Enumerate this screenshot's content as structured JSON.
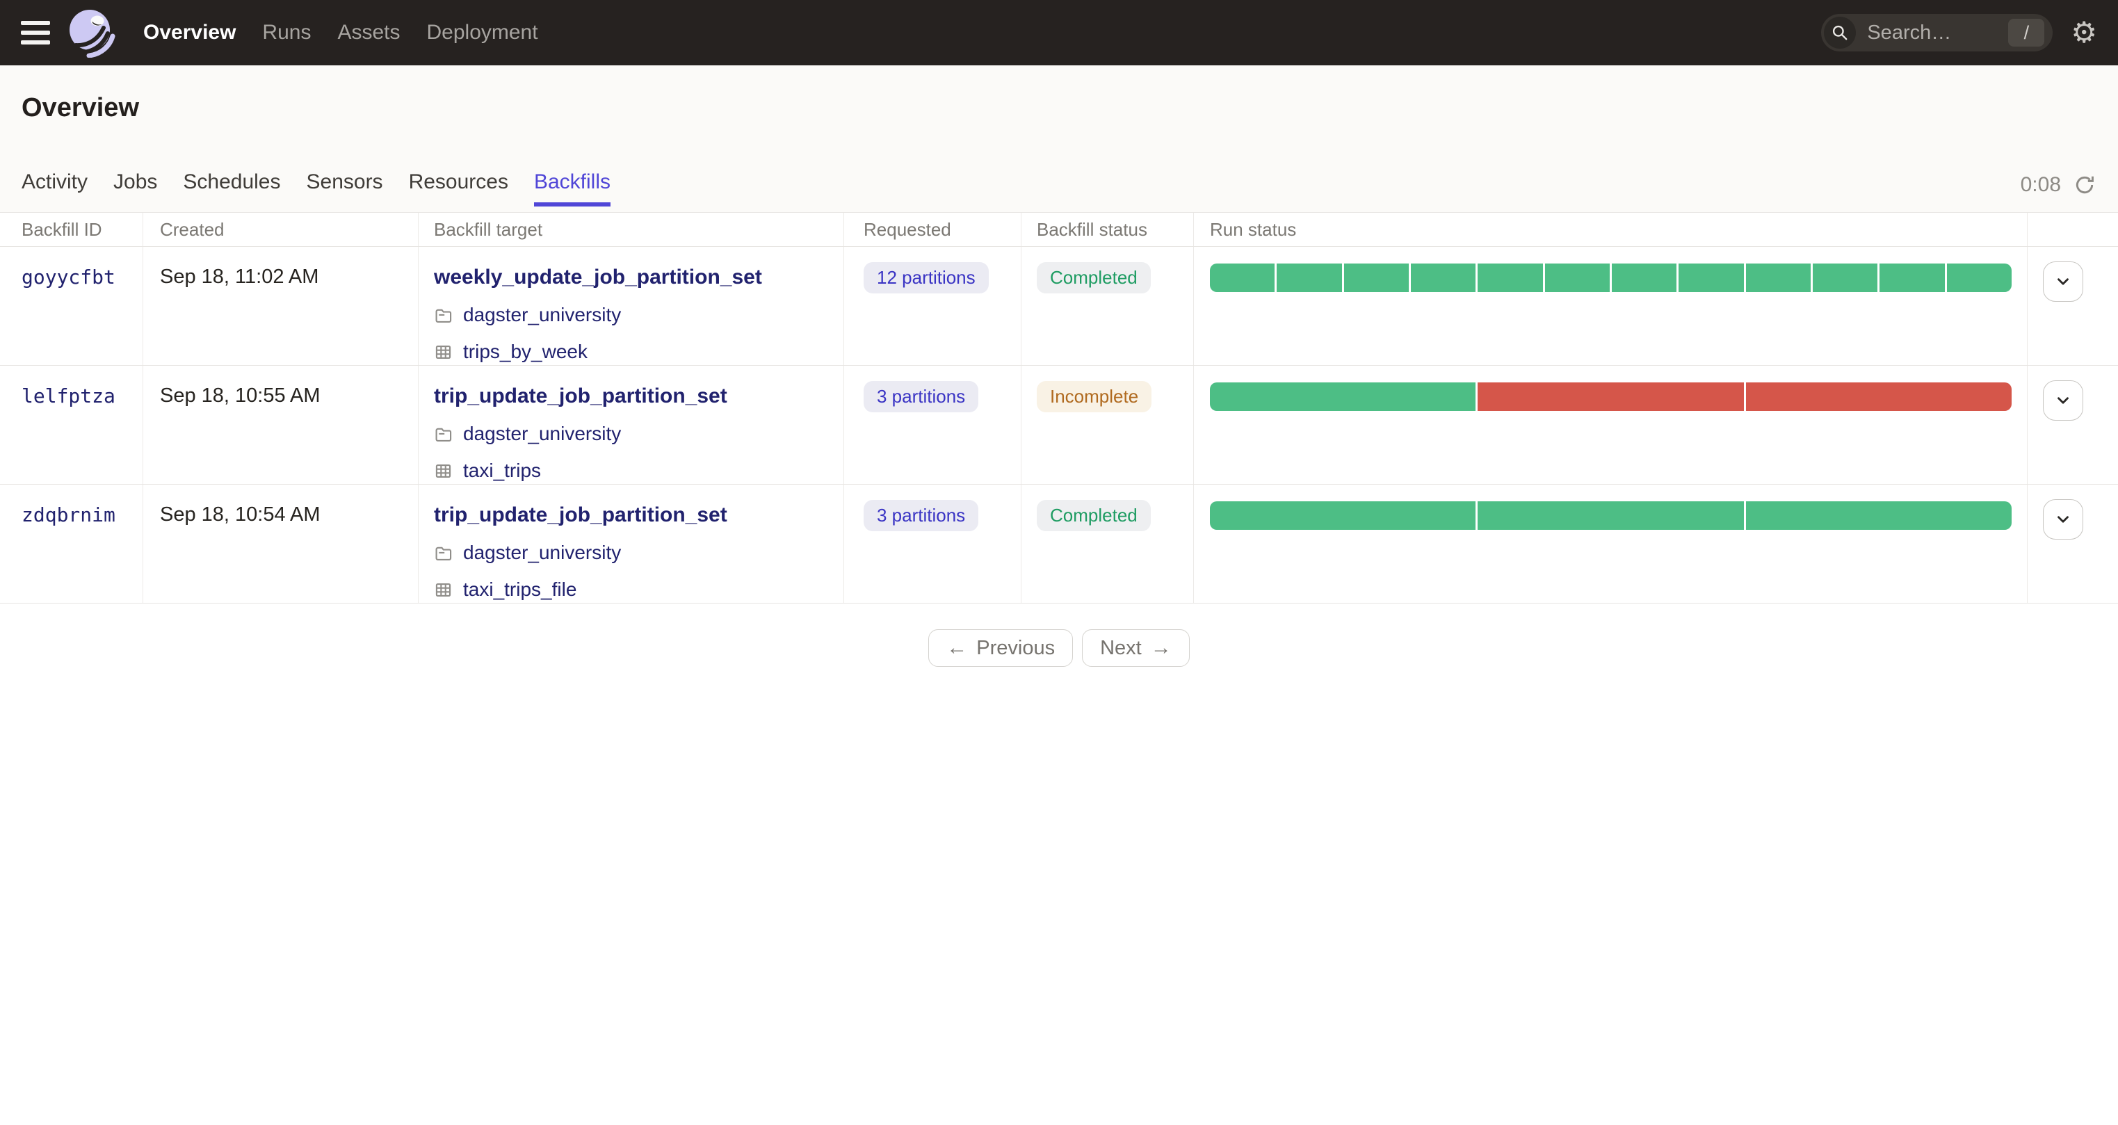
{
  "nav": {
    "items": [
      {
        "label": "Overview",
        "active": true
      },
      {
        "label": "Runs",
        "active": false
      },
      {
        "label": "Assets",
        "active": false
      },
      {
        "label": "Deployment",
        "active": false
      }
    ],
    "search": {
      "placeholder": "Search…",
      "shortcut": "/"
    }
  },
  "page": {
    "title": "Overview",
    "tabs": [
      {
        "label": "Activity"
      },
      {
        "label": "Jobs"
      },
      {
        "label": "Schedules"
      },
      {
        "label": "Sensors"
      },
      {
        "label": "Resources"
      },
      {
        "label": "Backfills",
        "active": true
      }
    ],
    "refresh_timer": "0:08"
  },
  "table": {
    "columns": [
      "Backfill ID",
      "Created",
      "Backfill target",
      "Requested",
      "Backfill status",
      "Run status"
    ],
    "rows": [
      {
        "id": "goyycfbt",
        "created": "Sep 18, 11:02 AM",
        "target": "weekly_update_job_partition_set",
        "code_location": "dagster_university",
        "table": "trips_by_week",
        "requested": "12 partitions",
        "status": {
          "label": "Completed",
          "type": "completed"
        },
        "run_status": {
          "segments": [
            "success",
            "success",
            "success",
            "success",
            "success",
            "success",
            "success",
            "success",
            "success",
            "success",
            "success",
            "success"
          ]
        }
      },
      {
        "id": "lelfptza",
        "created": "Sep 18, 10:55 AM",
        "target": "trip_update_job_partition_set",
        "code_location": "dagster_university",
        "table": "taxi_trips",
        "requested": "3 partitions",
        "status": {
          "label": "Incomplete",
          "type": "incomplete"
        },
        "run_status": {
          "segments": [
            "success",
            "failure",
            "failure"
          ]
        }
      },
      {
        "id": "zdqbrnim",
        "created": "Sep 18, 10:54 AM",
        "target": "trip_update_job_partition_set",
        "code_location": "dagster_university",
        "table": "taxi_trips_file",
        "requested": "3 partitions",
        "status": {
          "label": "Completed",
          "type": "completed"
        },
        "run_status": {
          "segments": [
            "success",
            "success",
            "success"
          ]
        }
      }
    ]
  },
  "pagination": {
    "previous_label": "Previous",
    "next_label": "Next",
    "prev_arrow": "←",
    "next_arrow": "→"
  },
  "status_colors": {
    "success": "#4DBE85",
    "failure": "#D5564A"
  },
  "colors": {
    "accent": "#5046D7",
    "link": "#21226E",
    "nav_bg": "#262220",
    "completed_text": "#1E9C62",
    "incomplete_text": "#B06A1F"
  },
  "icons": {
    "menu": "hamburger-bars",
    "logo": "dagster-octopus",
    "search": "magnifier",
    "shortcut": "/",
    "gear": "⚙",
    "refresh": "circular-arrow",
    "code_location": "folder",
    "partition_table": "grid-table",
    "expand": "chevron-down"
  }
}
